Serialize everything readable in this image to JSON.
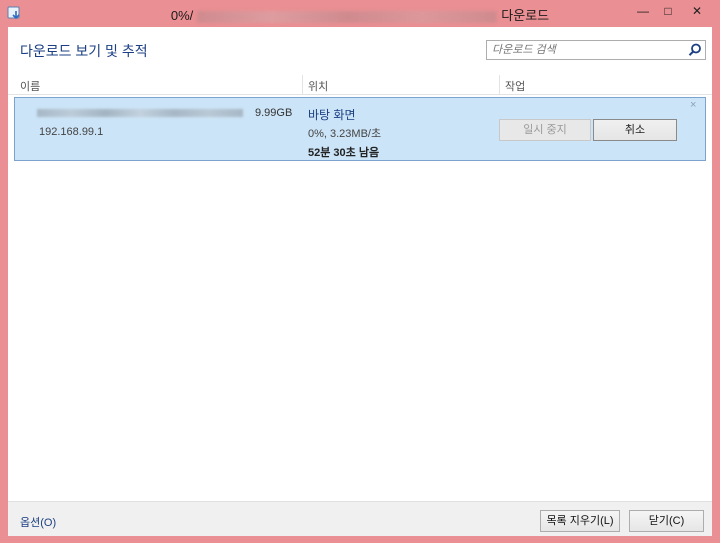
{
  "window": {
    "title_prefix": "0%/",
    "title_suffix": "다운로드",
    "minimize": "—",
    "maximize": "□",
    "close": "✕"
  },
  "header": {
    "title": "다운로드 보기 및 추적"
  },
  "search": {
    "placeholder": "다운로드 검색"
  },
  "columns": {
    "name": "이름",
    "location": "위치",
    "action": "작업"
  },
  "download": {
    "size": "9.99GB",
    "source": "192.168.99.1",
    "location": "바탕 화면",
    "progress_text": "0%, 3.23MB/초",
    "progress_fraction": 0,
    "remaining": "52분 30초 남음",
    "pause_label": "일시 중지",
    "cancel_label": "취소",
    "remove": "×"
  },
  "footer": {
    "options_label": "옵션(O)",
    "clear_list_label": "목록 지우기(L)",
    "close_label": "닫기(C)"
  },
  "colors": {
    "frame": "#ea8f93",
    "selection": "#cce4f7",
    "accent_text": "#1b3f82"
  }
}
